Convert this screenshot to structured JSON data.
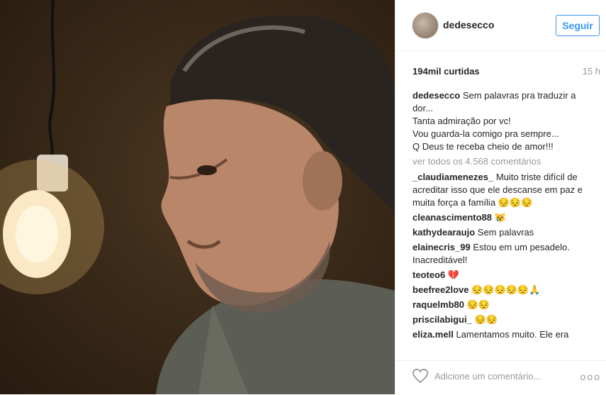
{
  "post": {
    "username": "dedesecco",
    "follow_label": "Seguir",
    "likes": "194mil curtidas",
    "time": "15 h",
    "caption_user": "dedesecco",
    "caption_text": "Sem palavras pra traduzir a dor...\nTanta admiração por vc!\nVou guarda-la comigo pra sempre...\nQ Deus te receba cheio de amor!!!",
    "view_all": "ver todos os 4.568 comentários",
    "comments": [
      {
        "user": "_claudiamenezes_",
        "text": "Muito triste difícil de acreditar isso que ele descanse em paz e muita força a família 😔😔😔"
      },
      {
        "user": "cleanascimento88",
        "text": "😿"
      },
      {
        "user": "kathydearaujo",
        "text": "Sem palavras"
      },
      {
        "user": "elainecris_99",
        "text": "Estou em um pesadelo. Inacreditável!"
      },
      {
        "user": "teoteo6",
        "text": "💔"
      },
      {
        "user": "beefree2love",
        "text": "😔😔😔😔😔🙏"
      },
      {
        "user": "raquelmb80",
        "text": "😔😔"
      },
      {
        "user": "priscilabigui_",
        "text": "😔😔"
      },
      {
        "user": "eliza.mell",
        "text": "Lamentamos muito. Ele era"
      }
    ],
    "add_comment_placeholder": "Adicione um comentário...",
    "more_label": "ooo"
  }
}
